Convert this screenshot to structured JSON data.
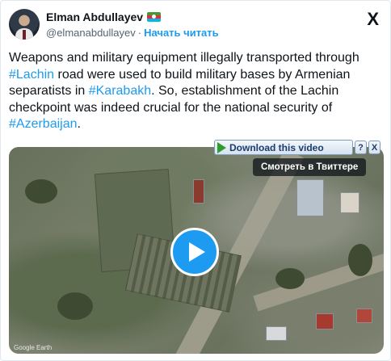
{
  "author": {
    "name": "Elman Abdullayev",
    "handle": "@elmanabdullayev",
    "separator": "·",
    "follow_label": "Начать читать"
  },
  "platform_logo": "X",
  "tweet": {
    "text_before_1": "Weapons and military equipment illegally transported through ",
    "tag_1": "#Lachin",
    "text_before_2": " road were used to build military bases by Armenian separatists in ",
    "tag_2": "#Karabakh",
    "text_before_3": ". So, establishment of the Lachin checkpoint was indeed crucial for the national security of ",
    "tag_3": "#Azerbaijan",
    "text_end": "."
  },
  "media": {
    "watermark": "Google Earth",
    "play_icon": "play-icon",
    "download_label": "Download this video",
    "help_label": "?",
    "close_label": "X",
    "watch_label": "Смотреть в Твиттере"
  },
  "colors": {
    "link": "#1d9bf0",
    "text": "#0f1419",
    "muted": "#536471"
  }
}
